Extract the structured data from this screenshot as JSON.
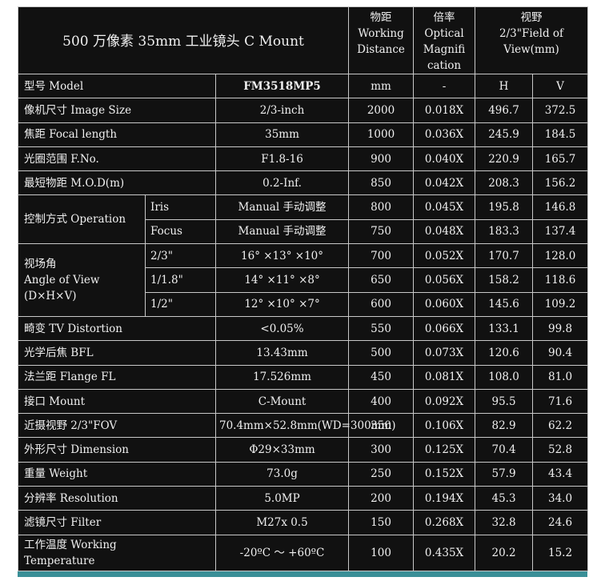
{
  "title": "500 万像素 35mm 工业镜头 C Mount",
  "headers": {
    "distance": [
      "物距",
      "Working",
      "Distance"
    ],
    "magnification": [
      "倍率",
      "Optical",
      "Magnifi",
      "cation"
    ],
    "fov": [
      "视野",
      "2/3\"Field of",
      "View(mm)"
    ]
  },
  "model_row": {
    "label": "型号 Model",
    "value": "FM3518MP5",
    "d": "mm",
    "m": "-",
    "h": "H",
    "v": "V"
  },
  "specs": [
    {
      "label": "像机尺寸 Image Size",
      "value": "2/3-inch"
    },
    {
      "label": "焦距 Focal length",
      "value": "35mm"
    },
    {
      "label": "光圈范围 F.No.",
      "value": "F1.8-16"
    },
    {
      "label": "最短物距 M.O.D(m)",
      "value": "0.2-Inf."
    },
    {
      "label": "控制方式 Operation",
      "subs": [
        {
          "name": "Iris",
          "value": "Manual 手动调整"
        },
        {
          "name": "Focus",
          "value": "Manual 手动调整"
        }
      ]
    },
    {
      "label_lines": [
        "视场角",
        "Angle of View",
        "(D×H×V)"
      ],
      "subs": [
        {
          "name": "2/3\"",
          "value": "16° ×13° ×10°"
        },
        {
          "name": "1/1.8\"",
          "value": "14° ×11° ×8°"
        },
        {
          "name": "1/2\"",
          "value": "12° ×10° ×7°"
        }
      ]
    },
    {
      "label": "畸变 TV Distortion",
      "value": "<0.05%"
    },
    {
      "label": "光学后焦 BFL",
      "value": "13.43mm"
    },
    {
      "label": "法兰距 Flange FL",
      "value": "17.526mm"
    },
    {
      "label": "接口 Mount",
      "value": "C-Mount"
    },
    {
      "label": "近摄视野 2/3\"FOV",
      "value": "70.4mm×52.8mm(WD=300mm)"
    },
    {
      "label": "外形尺寸 Dimension",
      "value": "Φ29×33mm"
    },
    {
      "label": "重量 Weight",
      "value": "73.0g"
    },
    {
      "label": "分辨率 Resolution",
      "value": "5.0MP"
    },
    {
      "label": "滤镜尺寸 Filter",
      "value": "M27x 0.5"
    },
    {
      "label_lines": [
        "工作温度 Working",
        "Temperature"
      ],
      "value": "-20ºC ～ +60ºC"
    }
  ],
  "measurements": [
    {
      "d": "2000",
      "m": "0.018X",
      "h": "496.7",
      "v": "372.5"
    },
    {
      "d": "1000",
      "m": "0.036X",
      "h": "245.9",
      "v": "184.5"
    },
    {
      "d": "900",
      "m": "0.040X",
      "h": "220.9",
      "v": "165.7"
    },
    {
      "d": "850",
      "m": "0.042X",
      "h": "208.3",
      "v": "156.2"
    },
    {
      "d": "800",
      "m": "0.045X",
      "h": "195.8",
      "v": "146.8"
    },
    {
      "d": "750",
      "m": "0.048X",
      "h": "183.3",
      "v": "137.4"
    },
    {
      "d": "700",
      "m": "0.052X",
      "h": "170.7",
      "v": "128.0"
    },
    {
      "d": "650",
      "m": "0.056X",
      "h": "158.2",
      "v": "118.6"
    },
    {
      "d": "600",
      "m": "0.060X",
      "h": "145.6",
      "v": "109.2"
    },
    {
      "d": "550",
      "m": "0.066X",
      "h": "133.1",
      "v": "99.8"
    },
    {
      "d": "500",
      "m": "0.073X",
      "h": "120.6",
      "v": "90.4"
    },
    {
      "d": "450",
      "m": "0.081X",
      "h": "108.0",
      "v": "81.0"
    },
    {
      "d": "400",
      "m": "0.092X",
      "h": "95.5",
      "v": "71.6"
    },
    {
      "d": "350",
      "m": "0.106X",
      "h": "82.9",
      "v": "62.2"
    },
    {
      "d": "300",
      "m": "0.125X",
      "h": "70.4",
      "v": "52.8"
    },
    {
      "d": "250",
      "m": "0.152X",
      "h": "57.9",
      "v": "43.4"
    },
    {
      "d": "200",
      "m": "0.194X",
      "h": "45.3",
      "v": "34.0"
    },
    {
      "d": "150",
      "m": "0.268X",
      "h": "32.8",
      "v": "24.6"
    },
    {
      "d": "100",
      "m": "0.435X",
      "h": "20.2",
      "v": "15.2"
    }
  ],
  "colors": {
    "background": "#111111",
    "border": "#c8c8c8",
    "text": "#f0f0f0",
    "accent_bar": "#3a8f97"
  }
}
